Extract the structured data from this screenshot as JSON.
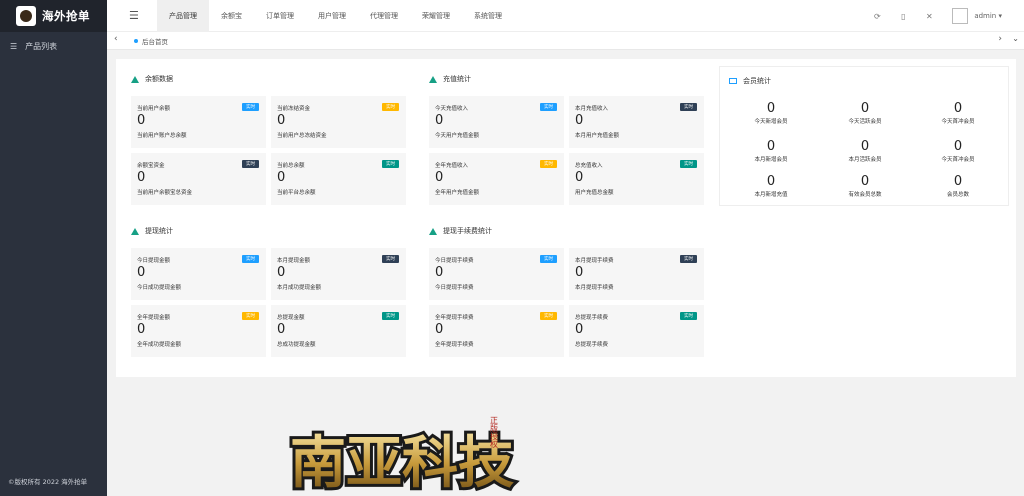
{
  "sidebar": {
    "logo_text": "海外抢单",
    "items": [
      {
        "label": "产品列表",
        "icon": "list-icon"
      }
    ],
    "footer": "©版权所有 2022 海外抢单"
  },
  "header": {
    "nav": [
      "产品管理",
      "余额宝",
      "订单管理",
      "用户管理",
      "代理管理",
      "荣耀管理",
      "系统管理"
    ],
    "active_index": 0,
    "user": "admin",
    "icons": [
      "refresh-icon",
      "lock-icon",
      "fullscreen-icon"
    ]
  },
  "tabbar": {
    "home": "后台首页"
  },
  "panels": [
    {
      "title": "余额数据",
      "cards": [
        {
          "label": "当前用户余额",
          "value": "0",
          "sub": "当前用户账户总余额",
          "badge": "实时",
          "color": "blue"
        },
        {
          "label": "当前冻结资金",
          "value": "0",
          "sub": "当前用户总冻结资金",
          "badge": "实时",
          "color": "orange"
        },
        {
          "label": "余额宝资金",
          "value": "0",
          "sub": "当前用户余额宝总资金",
          "badge": "实时",
          "color": "dark"
        },
        {
          "label": "当前总余额",
          "value": "0",
          "sub": "当前平台总余额",
          "badge": "实时",
          "color": "green"
        }
      ]
    },
    {
      "title": "充值统计",
      "cards": [
        {
          "label": "今天充值收入",
          "value": "0",
          "sub": "今天用户充值金额",
          "badge": "实时",
          "color": "blue"
        },
        {
          "label": "本月充值收入",
          "value": "0",
          "sub": "本月用户充值金额",
          "badge": "实时",
          "color": "dark"
        },
        {
          "label": "全年充值收入",
          "value": "0",
          "sub": "全年用户充值金额",
          "badge": "实时",
          "color": "orange"
        },
        {
          "label": "总充值收入",
          "value": "0",
          "sub": "用户充值总金额",
          "badge": "实时",
          "color": "green"
        }
      ]
    },
    {
      "title": "提现统计",
      "cards": [
        {
          "label": "今日提现金额",
          "value": "0",
          "sub": "今日成功提现金额",
          "badge": "实时",
          "color": "blue"
        },
        {
          "label": "本月提现金额",
          "value": "0",
          "sub": "本月成功提现金额",
          "badge": "实时",
          "color": "dark"
        },
        {
          "label": "全年提现金额",
          "value": "0",
          "sub": "全年成功提现金额",
          "badge": "实时",
          "color": "orange"
        },
        {
          "label": "总提现金额",
          "value": "0",
          "sub": "总成功提现金额",
          "badge": "实时",
          "color": "green"
        }
      ]
    },
    {
      "title": "提现手续费统计",
      "cards": [
        {
          "label": "今日提现手续费",
          "value": "0",
          "sub": "今日提现手续费",
          "badge": "实时",
          "color": "blue"
        },
        {
          "label": "本月提现手续费",
          "value": "0",
          "sub": "本月提现手续费",
          "badge": "实时",
          "color": "dark"
        },
        {
          "label": "全年提现手续费",
          "value": "0",
          "sub": "全年提现手续费",
          "badge": "实时",
          "color": "orange"
        },
        {
          "label": "总提现手续费",
          "value": "0",
          "sub": "总提现手续费",
          "badge": "实时",
          "color": "green"
        }
      ]
    }
  ],
  "member": {
    "title": "会员统计",
    "stats": [
      {
        "value": "0",
        "label": "今天新增会员"
      },
      {
        "value": "0",
        "label": "今天活跃会员"
      },
      {
        "value": "0",
        "label": "今天首冲会员"
      },
      {
        "value": "0",
        "label": "本月新增会员"
      },
      {
        "value": "0",
        "label": "本月活跃会员"
      },
      {
        "value": "0",
        "label": "今天首冲会员"
      },
      {
        "value": "0",
        "label": "本月新增充值"
      },
      {
        "value": "0",
        "label": "有效会员总数"
      },
      {
        "value": "0",
        "label": "会员总数"
      }
    ]
  },
  "watermark": {
    "text": "南亚科技",
    "tag": "正版授权"
  },
  "colors": {
    "blue": "#1e9fff",
    "orange": "#ffb800",
    "dark": "#2f4056",
    "green": "#009688",
    "sidebar": "#2b313d"
  }
}
